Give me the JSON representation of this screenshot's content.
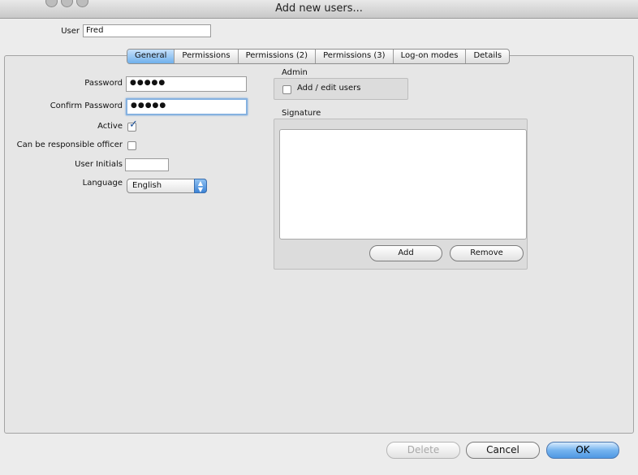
{
  "window": {
    "title": "Add new users..."
  },
  "user": {
    "label": "User",
    "value": "Fred"
  },
  "tabs": [
    "General",
    "Permissions",
    "Permissions (2)",
    "Permissions (3)",
    "Log-on modes",
    "Details"
  ],
  "general": {
    "password_label": "Password",
    "password_value": "●●●●●",
    "confirm_label": "Confirm Password",
    "confirm_value": "●●●●●",
    "active_label": "Active",
    "responsible_label": "Can be responsible officer",
    "initials_label": "User Initials",
    "initials_value": "",
    "language_label": "Language",
    "language_value": "English"
  },
  "admin": {
    "title": "Admin",
    "add_edit_label": "Add / edit users"
  },
  "signature": {
    "title": "Signature",
    "add_label": "Add",
    "remove_label": "Remove"
  },
  "footer": {
    "delete_label": "Delete",
    "cancel_label": "Cancel",
    "ok_label": "OK"
  }
}
